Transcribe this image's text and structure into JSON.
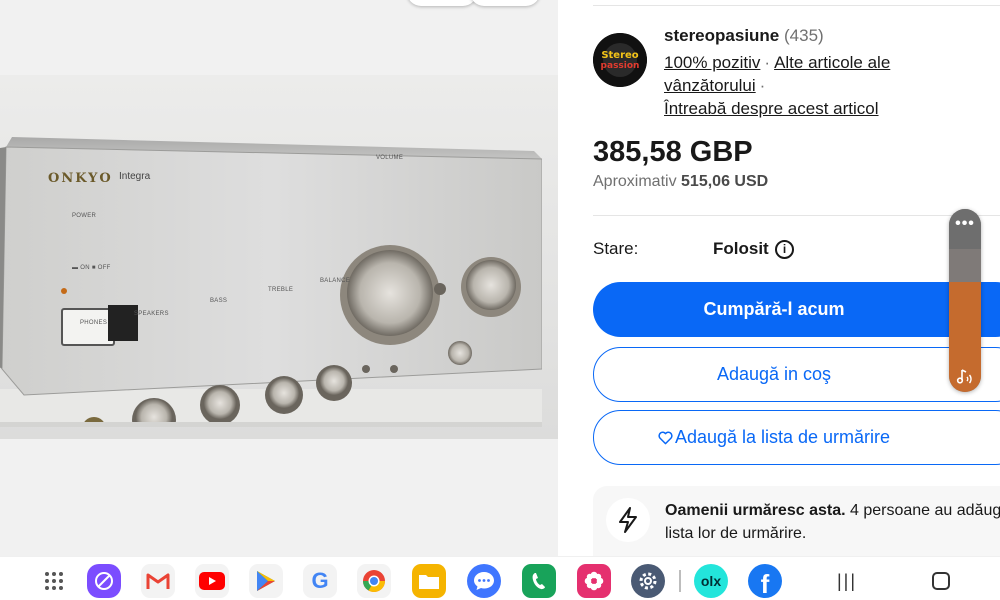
{
  "seller": {
    "name": "stereopasiune",
    "feedback_count": "(435)",
    "positive": "100% pozitiv",
    "separator": "·",
    "other_items": "Alte articole ale vânzătorului",
    "ask": "Întreabă despre acest articol",
    "avatar_line1": "Stereo",
    "avatar_line2": "passion"
  },
  "listing": {
    "price": "385,58 GBP",
    "approx_label": "Aproximativ",
    "approx_value": "515,06 USD",
    "condition_label": "Stare:",
    "condition_value": "Folosit"
  },
  "actions": {
    "buy_now": "Cumpără-l acum",
    "add_to_cart": "Adaugă in coş",
    "add_to_watchlist": "Adaugă la lista de urmărire"
  },
  "social": {
    "bold": "Oamenii urmăresc asta.",
    "text": " 4 persoane au adăug",
    "text2": "lista lor de urmărire."
  },
  "product_image": {
    "brand": "ONKYO",
    "model": "Integra",
    "labels": {
      "power": "POWER",
      "on_off": "▬ ON ■ OFF",
      "phones": "PHONES",
      "speakers": "SPEAKERS",
      "bass": "BASS",
      "treble": "TREBLE",
      "balance": "BALANCE",
      "volume": "VOLUME"
    }
  },
  "volume_panel": {
    "menu_glyph": "•••",
    "level": 0.6
  },
  "taskbar": {
    "apps": [
      {
        "name": "apps-grid-icon",
        "color": "#555555"
      },
      {
        "name": "internet-icon",
        "color": "#7b4dff"
      },
      {
        "name": "gmail-icon",
        "color": "#ea4335"
      },
      {
        "name": "youtube-icon",
        "color": "#ff0000"
      },
      {
        "name": "play-store-icon",
        "color": "#34a853"
      },
      {
        "name": "google-icon",
        "color": "#4285f4"
      },
      {
        "name": "chrome-icon",
        "color": "#fbbc05"
      },
      {
        "name": "files-icon",
        "color": "#f5b400"
      },
      {
        "name": "messages-icon",
        "color": "#3f76ff"
      },
      {
        "name": "phone-icon",
        "color": "#18a35a"
      },
      {
        "name": "gallery-icon",
        "color": "#e5306f"
      },
      {
        "name": "settings-icon",
        "color": "#4a5a74"
      },
      {
        "name": "olx-icon",
        "color": "#23e5db"
      },
      {
        "name": "facebook-icon",
        "color": "#1877f2"
      }
    ],
    "nav_recent": "|||",
    "olx_text": "olx"
  },
  "colors": {
    "primary": "#0968f6",
    "volume_fill": "#c56b2e"
  }
}
